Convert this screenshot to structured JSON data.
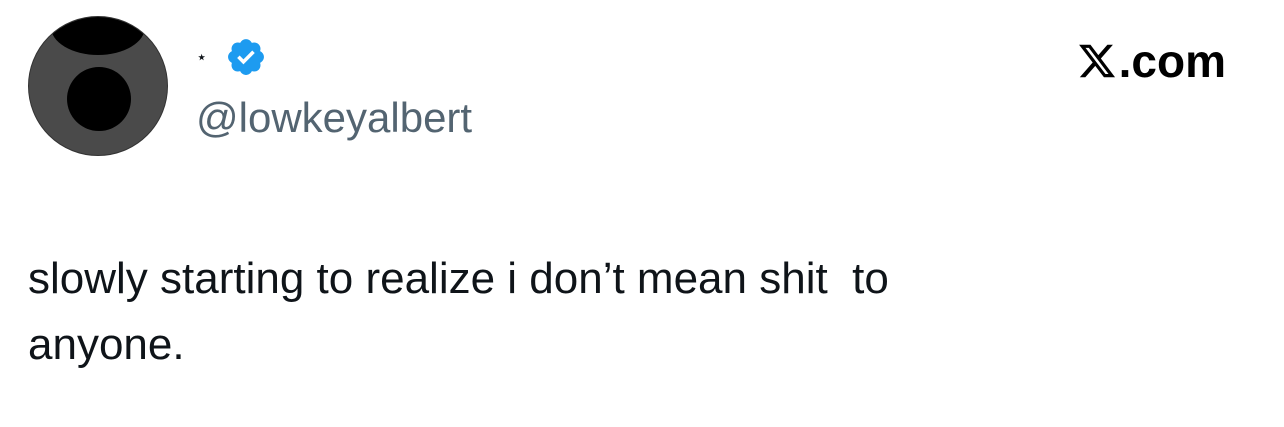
{
  "author": {
    "display_name": "⋆",
    "handle": "@lowkeyalbert",
    "verified_icon": "verified-badge-icon",
    "verified_color": "#1d9bf0",
    "avatar_icon": "avatar-abstract-icon"
  },
  "brand": {
    "logo_icon": "x-logo-icon",
    "suffix": ".com"
  },
  "tweet": {
    "text": "slowly starting to realize i don’t mean shit  to\nanyone."
  },
  "colors": {
    "text": "#0f1419",
    "secondary_text": "#536471",
    "background": "#ffffff"
  }
}
